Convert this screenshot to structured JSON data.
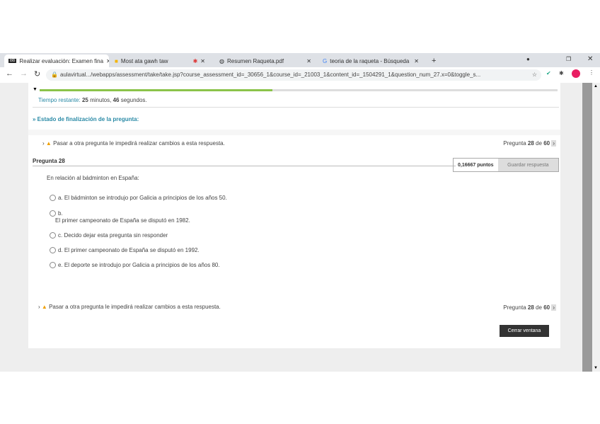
{
  "browser": {
    "tabs": [
      {
        "label": "Realizar evaluación: Examen fina",
        "active": true
      },
      {
        "label": "Most   ata gawh taw",
        "active": false
      },
      {
        "label": "",
        "active": false
      },
      {
        "label": "Resumen Raqueta.pdf",
        "active": false
      },
      {
        "label": "teoria de la raqueta - Búsqueda",
        "active": false
      }
    ],
    "new_tab": "+",
    "url": "aulavirtual.../webapps/assessment/take/take.jsp?course_assessment_id=_30656_1&course_id=_21003_1&content_id=_1504291_1&question_num_27.x=0&toggle_s..."
  },
  "quiz": {
    "progress_percent": 45,
    "timer_label": "Tiempo restante:",
    "timer_minutes": "25",
    "timer_minutes_unit": "minutos,",
    "timer_seconds": "46",
    "timer_seconds_unit": "segundos.",
    "status_label": "Estado de finalización de la pregunta:",
    "warning": "Pasar a otra pregunta le impedirá realizar cambios a esta respuesta.",
    "nav_prefix": "Pregunta",
    "nav_current": "28",
    "nav_of": "de",
    "nav_total": "60",
    "question_title": "Pregunta 28",
    "points": "0,16667 puntos",
    "save_label": "Guardar respuesta",
    "question_text": "En relación al bádminton en España:",
    "options": [
      "a. El bádminton se introdujo por Galicia a principios de los años 50.",
      "b.",
      "c. Decido dejar esta pregunta sin responder",
      "d. El primer campeonato de España se disputó en 1992.",
      "e. El deporte se introdujo por Galicia a principios de los años 80."
    ],
    "option_b_text": "El primer campeonato de España se disputó en 1982.",
    "close_label": "Cerrar ventana"
  },
  "colors": {
    "progress": "#8bc34a",
    "heading": "#2a8aa6",
    "close_btn": "#333333"
  }
}
